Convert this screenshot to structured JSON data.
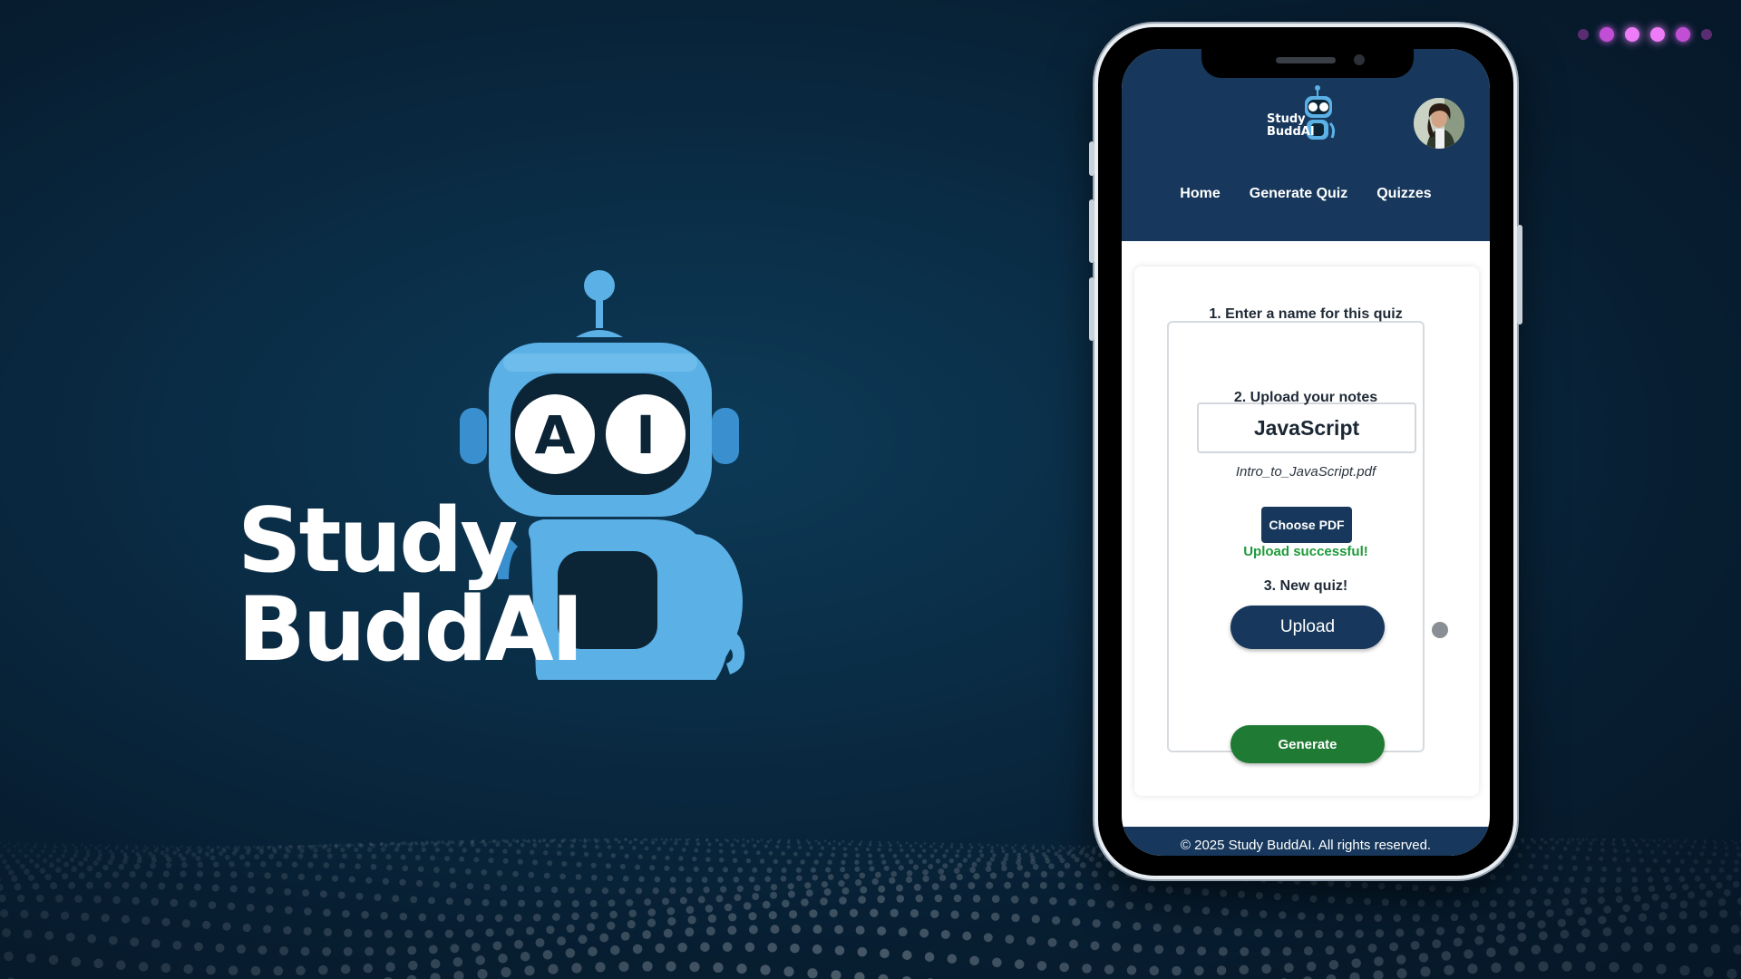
{
  "hero": {
    "wordmark_line1": "Study",
    "wordmark_line2": "BuddAI",
    "robot_visor_letters": [
      "A",
      "I"
    ]
  },
  "slideshow": {
    "dots": 6,
    "active_dot": 3
  },
  "app": {
    "logo_text_line1": "Study",
    "logo_text_line2": "BuddAI",
    "nav": [
      "Home",
      "Generate Quiz",
      "Quizzes"
    ],
    "form": {
      "step1_label": "1. Enter a name for this quiz",
      "quiz_name_value": "JavaScript",
      "step2_label": "2. Upload your notes",
      "choose_pdf_label": "Choose PDF",
      "selected_file": "Intro_to_JavaScript.pdf",
      "upload_label": "Upload",
      "upload_status": "Upload successful!",
      "step3_label": "3. New quiz!",
      "generate_label": "Generate"
    },
    "footer": "© 2025 Study BuddAI. All rights reserved."
  },
  "colors": {
    "background": "#0a2c45",
    "brand_navy": "#17385c",
    "robot_blue": "#5bb0e6",
    "success_green": "#1f9a3a",
    "generate_green": "#1f7a33",
    "accent_pink": "#ee7cf9"
  },
  "icons": [
    "robot-logo-icon",
    "avatar-icon",
    "cursor-icon"
  ]
}
